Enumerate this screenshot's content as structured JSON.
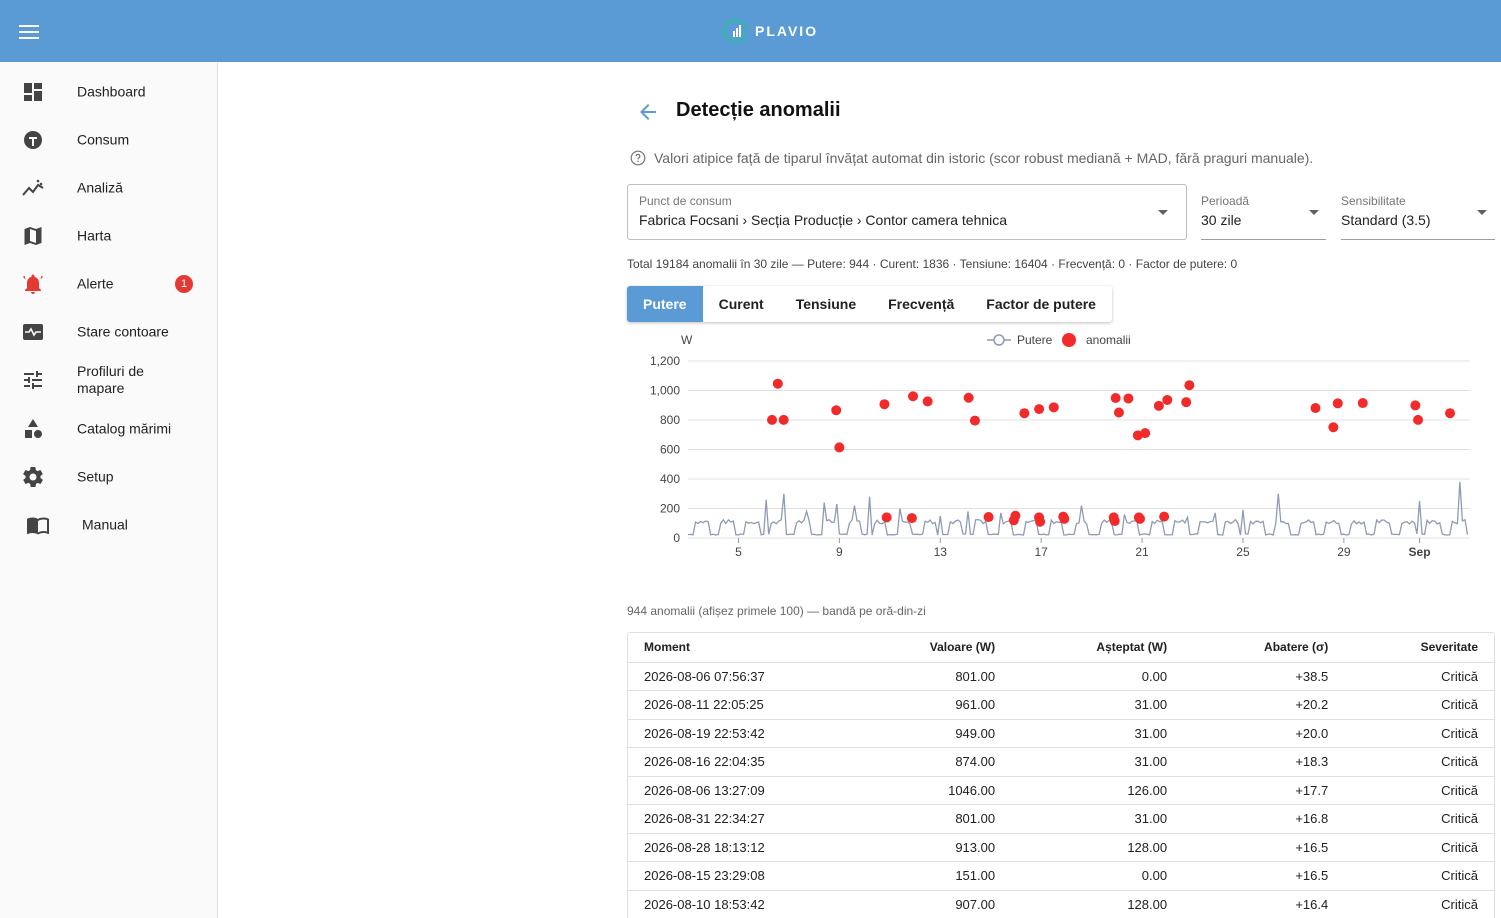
{
  "brand": {
    "name": "PLAVIO",
    "logo_icon": "plavio-logo-icon",
    "accent_color": "#5b9bd5"
  },
  "sidebar": {
    "items": [
      {
        "label": "Dashboard",
        "icon": "dashboard-icon"
      },
      {
        "label": "Consum",
        "icon": "meter-icon"
      },
      {
        "label": "Analiză",
        "icon": "analytics-icon"
      },
      {
        "label": "Harta",
        "icon": "map-icon"
      },
      {
        "label": "Alerte",
        "icon": "bell-alert-icon",
        "badge": "1"
      },
      {
        "label": "Stare contoare",
        "icon": "monitor-heart-icon"
      },
      {
        "label": "Profiluri de mapare",
        "icon": "tune-icon"
      },
      {
        "label": "Catalog mărimi",
        "icon": "category-icon"
      },
      {
        "label": "Setup",
        "icon": "gear-icon"
      },
      {
        "label": "Manual",
        "icon": "book-icon"
      }
    ]
  },
  "page": {
    "title": "Detecție anomalii",
    "help_text": "Valori atipice față de tiparul învățat automat din istoric (scor robust mediană + MAD, fără praguri manuale)."
  },
  "filters": {
    "point": {
      "label": "Punct de consum",
      "value": "Fabrica Focsani › Secția Producție › Contor camera tehnica"
    },
    "period": {
      "label": "Perioadă",
      "value": "30 zile"
    },
    "sensitivity": {
      "label": "Sensibilitate",
      "value": "Standard (3.5)"
    }
  },
  "summary": "Total 19184 anomalii în 30 zile — Putere: 944 · Curent: 1836 · Tensiune: 16404 · Frecvență: 0 · Factor de putere: 0",
  "tabs": [
    "Putere",
    "Curent",
    "Tensiune",
    "Frecvență",
    "Factor de putere"
  ],
  "active_tab": 0,
  "chart_data": {
    "type": "line",
    "ylabel": "W",
    "ylim": [
      0,
      1200
    ],
    "yticks": [
      0,
      200,
      400,
      600,
      800,
      1000,
      1200
    ],
    "ytick_labels": [
      "0",
      "200",
      "400",
      "600",
      "800",
      "1,000",
      "1,200"
    ],
    "xlim": [
      "2026-08-03",
      "2026-09-03"
    ],
    "xticks": [
      "2026-08-05",
      "2026-08-09",
      "2026-08-13",
      "2026-08-17",
      "2026-08-21",
      "2026-08-25",
      "2026-08-29",
      "2026-09-01"
    ],
    "xtick_labels": [
      "5",
      "9",
      "13",
      "17",
      "21",
      "25",
      "29",
      "Sep"
    ],
    "legend": {
      "position": "top",
      "entries": [
        "Putere",
        "anomalii"
      ]
    },
    "colors": {
      "line": "#8e9bb5",
      "anomaly": "#f22a2a",
      "grid": "#e0e0e0"
    },
    "series": [
      {
        "name": "Putere",
        "type": "line",
        "baseline": 20,
        "day_peak": 110,
        "spikes": [
          [
            3.1,
            260
          ],
          [
            3.8,
            300
          ],
          [
            4.7,
            180
          ],
          [
            5.4,
            240
          ],
          [
            5.9,
            230
          ],
          [
            6.6,
            220
          ],
          [
            7.2,
            280
          ],
          [
            8.4,
            200
          ],
          [
            10.0,
            150
          ],
          [
            11.1,
            180
          ],
          [
            12.4,
            170
          ],
          [
            15.6,
            220
          ],
          [
            17.3,
            160
          ],
          [
            19.8,
            140
          ],
          [
            20.9,
            170
          ],
          [
            22.0,
            190
          ],
          [
            23.4,
            300
          ],
          [
            29.0,
            250
          ],
          [
            30.6,
            380
          ]
        ]
      },
      {
        "name": "anomalii",
        "type": "scatter",
        "points": [
          [
            "2026-08-06T07:56",
            801
          ],
          [
            "2026-08-06T13:27",
            1046
          ],
          [
            "2026-08-06T19:00",
            801
          ],
          [
            "2026-08-08T21:00",
            866
          ],
          [
            "2026-08-09T00:00",
            614
          ],
          [
            "2026-08-10T18:53",
            907
          ],
          [
            "2026-08-11T22:05",
            961
          ],
          [
            "2026-08-12T12:00",
            926
          ],
          [
            "2026-08-14T03:00",
            951
          ],
          [
            "2026-08-14T09:00",
            796
          ],
          [
            "2026-08-16T08:00",
            846
          ],
          [
            "2026-08-16T22:04",
            874
          ],
          [
            "2026-08-17T12:00",
            886
          ],
          [
            "2026-08-19T22:53",
            949
          ],
          [
            "2026-08-20T02:00",
            851
          ],
          [
            "2026-08-20T11:00",
            946
          ],
          [
            "2026-08-20T20:00",
            696
          ],
          [
            "2026-08-21T03:00",
            711
          ],
          [
            "2026-08-21T16:00",
            896
          ],
          [
            "2026-08-22T00:00",
            936
          ],
          [
            "2026-08-22T18:00",
            921
          ],
          [
            "2026-08-22T21:00",
            1036
          ],
          [
            "2026-08-27T21:00",
            881
          ],
          [
            "2026-08-28T18:13",
            913
          ],
          [
            "2026-08-28T14:00",
            751
          ],
          [
            "2026-08-29T18:00",
            915
          ],
          [
            "2026-08-31T22:34",
            801
          ],
          [
            "2026-08-31T20:00",
            899
          ],
          [
            "2026-09-02T05:00",
            846
          ],
          [
            "2026-08-10T21:00",
            140
          ],
          [
            "2026-08-11T21:00",
            135
          ],
          [
            "2026-08-14T22:00",
            142
          ],
          [
            "2026-08-15T23:29",
            151
          ],
          [
            "2026-08-15T22:00",
            120
          ],
          [
            "2026-08-16T22:00",
            140
          ],
          [
            "2026-08-16T23:00",
            110
          ],
          [
            "2026-08-17T21:00",
            145
          ],
          [
            "2026-08-17T22:00",
            130
          ],
          [
            "2026-08-19T21:00",
            140
          ],
          [
            "2026-08-19T22:00",
            115
          ],
          [
            "2026-08-20T21:00",
            140
          ],
          [
            "2026-08-20T22:00",
            130
          ],
          [
            "2026-08-21T21:00",
            145
          ]
        ]
      }
    ]
  },
  "table": {
    "caption": "944 anomalii (afișez primele 100) — bandă pe oră-din-zi",
    "columns": [
      "Moment",
      "Valoare (W)",
      "Așteptat (W)",
      "Abatere (σ)",
      "Severitate"
    ],
    "rows": [
      [
        "2026-08-06 07:56:37",
        "801.00",
        "0.00",
        "+38.5",
        "Critică"
      ],
      [
        "2026-08-11 22:05:25",
        "961.00",
        "31.00",
        "+20.2",
        "Critică"
      ],
      [
        "2026-08-19 22:53:42",
        "949.00",
        "31.00",
        "+20.0",
        "Critică"
      ],
      [
        "2026-08-16 22:04:35",
        "874.00",
        "31.00",
        "+18.3",
        "Critică"
      ],
      [
        "2026-08-06 13:27:09",
        "1046.00",
        "126.00",
        "+17.7",
        "Critică"
      ],
      [
        "2026-08-31 22:34:27",
        "801.00",
        "31.00",
        "+16.8",
        "Critică"
      ],
      [
        "2026-08-28 18:13:12",
        "913.00",
        "128.00",
        "+16.5",
        "Critică"
      ],
      [
        "2026-08-15 23:29:08",
        "151.00",
        "0.00",
        "+16.5",
        "Critică"
      ],
      [
        "2026-08-10 18:53:42",
        "907.00",
        "128.00",
        "+16.4",
        "Critică"
      ]
    ]
  }
}
